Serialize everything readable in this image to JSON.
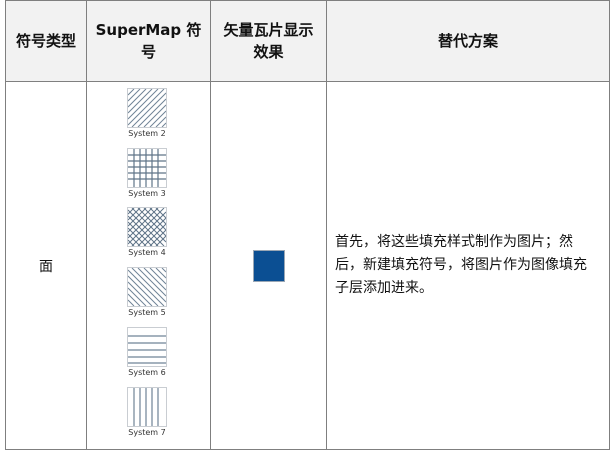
{
  "headers": {
    "symbol_type": "符号类型",
    "supermap_symbol": "SuperMap 符号",
    "vector_tile_effect": "矢量瓦片显示效果",
    "alternative": "替代方案"
  },
  "row": {
    "symbol_type": "面",
    "symbols": [
      {
        "label": "System 2",
        "pattern": "diagonal-lines"
      },
      {
        "label": "System 3",
        "pattern": "grid"
      },
      {
        "label": "System 4",
        "pattern": "cross-hatch"
      },
      {
        "label": "System 5",
        "pattern": "diagonal-lines"
      },
      {
        "label": "System 6",
        "pattern": "horizontal-lines"
      },
      {
        "label": "System 7",
        "pattern": "vertical-lines"
      }
    ],
    "effect_color": "#0b4f93",
    "alternative": "首先，将这些填充样式制作为图片；然后，新建填充符号，将图片作为图像填充子层添加进来。"
  },
  "colors": {
    "border": "#7f7f7f",
    "header_bg": "#f2f2f2",
    "hatch": "#6f8396"
  }
}
